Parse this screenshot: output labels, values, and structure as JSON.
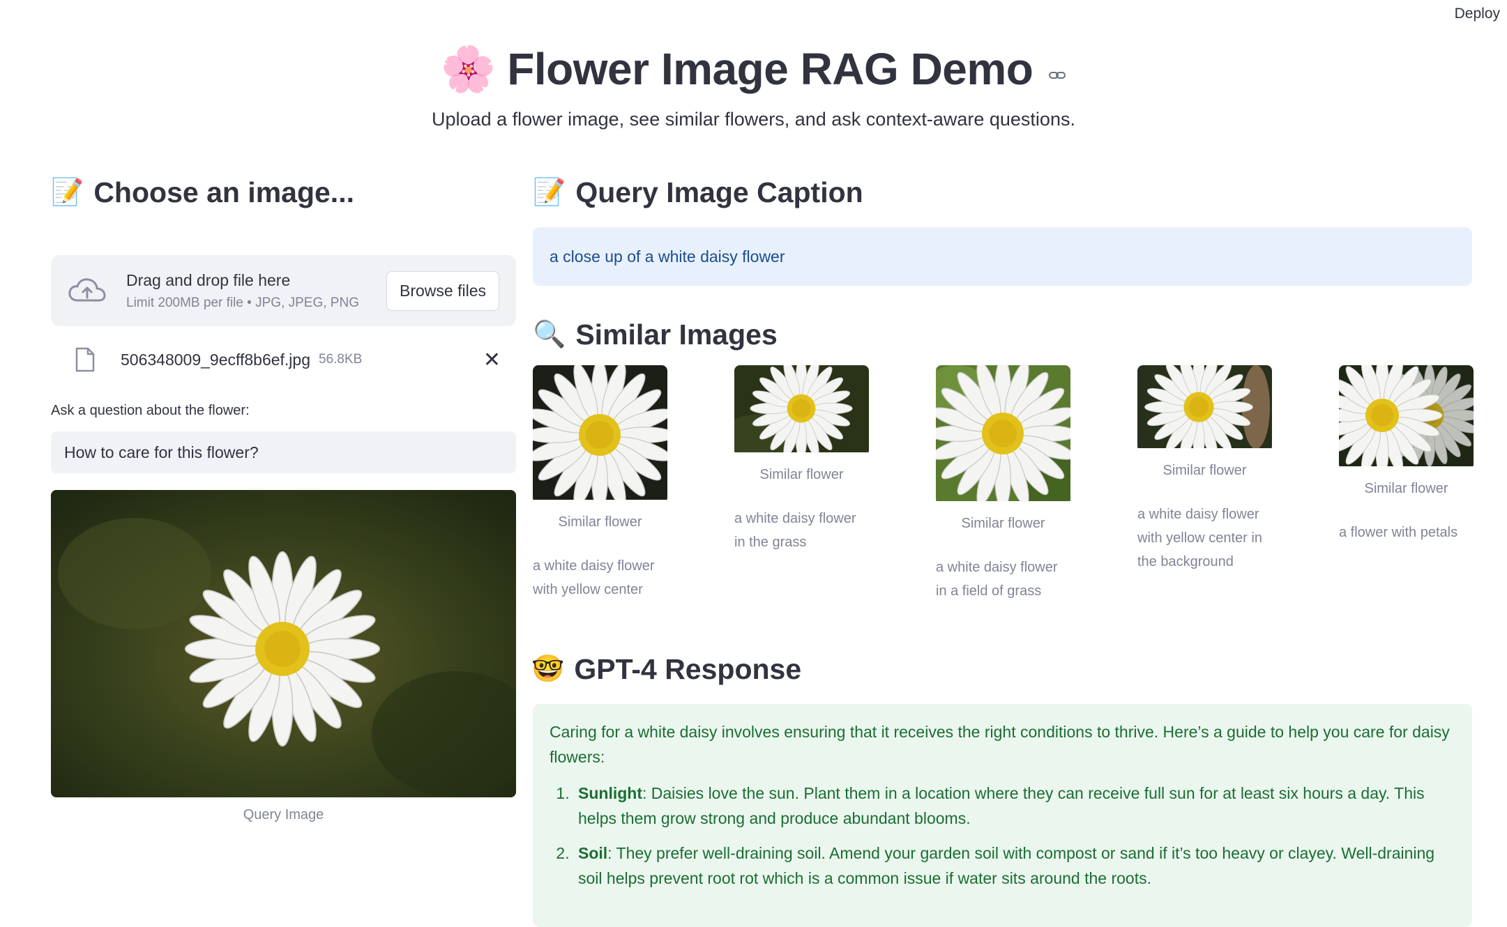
{
  "toolbar": {
    "deploy_label": "Deploy"
  },
  "header": {
    "emoji": "🌸",
    "title": "Flower Image RAG Demo",
    "subtitle": "Upload a flower image, see similar flowers, and ask context-aware questions."
  },
  "left": {
    "heading_emoji": "📝",
    "heading": "Choose an image...",
    "uploader": {
      "drop_text": "Drag and drop file here",
      "limit_text": "Limit 200MB per file • JPG, JPEG, PNG",
      "browse_label": "Browse files"
    },
    "file": {
      "name": "506348009_9ecff8b6ef.jpg",
      "size": "56.8KB"
    },
    "question_label": "Ask a question about the flower:",
    "question_value": "How to care for this flower?",
    "query_caption": "Query Image"
  },
  "right": {
    "caption_heading_emoji": "📝",
    "caption_heading": "Query Image Caption",
    "caption_text": "a close up of a white daisy flower",
    "similar_heading_emoji": "🔍",
    "similar_heading": "Similar Images",
    "similar": [
      {
        "caption": "Similar flower",
        "description": "a white daisy flower with yellow center"
      },
      {
        "caption": "Similar flower",
        "description": "a white daisy flower in the grass"
      },
      {
        "caption": "Similar flower",
        "description": "a white daisy flower in a field of grass"
      },
      {
        "caption": "Similar flower",
        "description": "a white daisy flower with yellow center in the background"
      },
      {
        "caption": "Similar flower",
        "description": "a flower with petals"
      }
    ],
    "gpt_heading_emoji": "🤓",
    "gpt_heading": "GPT-4 Response",
    "response": {
      "intro": "Caring for a white daisy involves ensuring that it receives the right conditions to thrive. Here’s a guide to help you care for daisy flowers:",
      "items": [
        {
          "term": "Sunlight",
          "text": ": Daisies love the sun. Plant them in a location where they can receive full sun for at least six hours a day. This helps them grow strong and produce abundant blooms."
        },
        {
          "term": "Soil",
          "text": ": They prefer well-draining soil. Amend your garden soil with compost or sand if it’s too heavy or clayey. Well-draining soil helps prevent root rot which is a common issue if water sits around the roots."
        }
      ]
    }
  },
  "colors": {
    "info_bg": "#e8f0fb",
    "info_text": "#1a4d8f",
    "success_bg": "#ebf6ee",
    "success_text": "#1a6e33",
    "uploader_bg": "#f0f2f6"
  }
}
